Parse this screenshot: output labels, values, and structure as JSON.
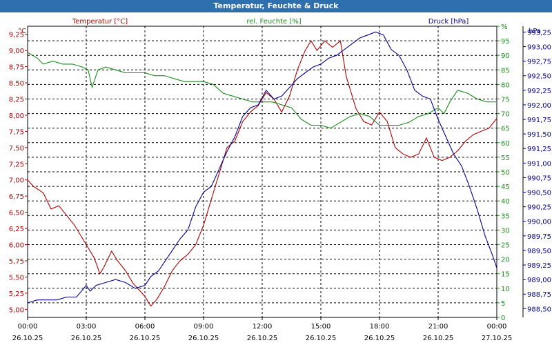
{
  "chart_data": {
    "type": "line",
    "title": "Temperatur, Feuchte & Druck",
    "legend": [
      {
        "label": "Temperatur [°C]",
        "color": "#b00000"
      },
      {
        "label": "rel. Feuchte [%]",
        "color": "#1a8a1a"
      },
      {
        "label": "Druck [hPa]",
        "color": "#00008c"
      }
    ],
    "axis_units": {
      "left": "°C",
      "right_inner": "%",
      "right_outer": "hPa"
    },
    "x_ticks": [
      {
        "time": "00:00",
        "date": "26.10.25"
      },
      {
        "time": "03:00",
        "date": "26.10.25"
      },
      {
        "time": "06:00",
        "date": "26.10.25"
      },
      {
        "time": "09:00",
        "date": "26.10.25"
      },
      {
        "time": "12:00",
        "date": "26.10.25"
      },
      {
        "time": "15:00",
        "date": "26.10.25"
      },
      {
        "time": "18:00",
        "date": "26.10.25"
      },
      {
        "time": "21:00",
        "date": "26.10.25"
      },
      {
        "time": "00:00",
        "date": "27.10.25"
      }
    ],
    "x_range_hours": [
      0,
      24
    ],
    "temp_axis": {
      "min": 4.875,
      "max": 9.375,
      "ticks": [
        "5,00",
        "5,25",
        "5,50",
        "5,75",
        "6,00",
        "6,25",
        "6,50",
        "6,75",
        "7,00",
        "7,25",
        "7,50",
        "7,75",
        "8,00",
        "8,25",
        "8,50",
        "8,75",
        "9,00",
        "9,25"
      ]
    },
    "humidity_axis": {
      "min": 0,
      "max": 100,
      "ticks": [
        "0",
        "5",
        "10",
        "15",
        "20",
        "25",
        "30",
        "35",
        "40",
        "45",
        "50",
        "55",
        "60",
        "65",
        "70",
        "75",
        "80",
        "85",
        "90",
        "95",
        "%"
      ]
    },
    "pressure_axis": {
      "min": 988.35,
      "max": 993.35,
      "ticks": [
        "988,50",
        "988,75",
        "989,00",
        "989,25",
        "989,50",
        "989,75",
        "990,00",
        "990,25",
        "990,50",
        "990,75",
        "991,00",
        "991,25",
        "991,50",
        "991,75",
        "992,00",
        "992,25",
        "992,50",
        "992,75",
        "993,00",
        "993,25"
      ]
    },
    "grid": true,
    "series": [
      {
        "name": "Temperatur [°C]",
        "color": "#b00000",
        "x": [
          0,
          0.3,
          0.8,
          1.2,
          1.6,
          2.0,
          2.4,
          2.8,
          3.0,
          3.4,
          3.7,
          3.9,
          4.3,
          4.6,
          5.0,
          5.4,
          5.7,
          6.0,
          6.3,
          6.6,
          7.0,
          7.4,
          7.8,
          8.2,
          8.6,
          9.0,
          9.4,
          9.8,
          10.2,
          10.6,
          11.0,
          11.4,
          11.8,
          12.2,
          12.6,
          13.0,
          13.4,
          13.8,
          14.2,
          14.5,
          14.8,
          15.2,
          15.6,
          16.0,
          16.3,
          16.8,
          17.2,
          17.6,
          18.0,
          18.4,
          18.8,
          19.2,
          19.6,
          20.0,
          20.4,
          20.8,
          21.2,
          21.6,
          22.0,
          22.4,
          22.8,
          23.2,
          23.6,
          24.0
        ],
        "y": [
          7.0,
          6.9,
          6.8,
          6.55,
          6.6,
          6.45,
          6.3,
          6.1,
          6.0,
          5.8,
          5.55,
          5.65,
          5.9,
          5.75,
          5.6,
          5.4,
          5.3,
          5.2,
          5.05,
          5.15,
          5.35,
          5.6,
          5.75,
          5.85,
          6.0,
          6.3,
          6.7,
          7.1,
          7.5,
          7.6,
          7.9,
          8.05,
          8.15,
          8.35,
          8.25,
          8.05,
          8.3,
          8.7,
          9.0,
          9.15,
          9.0,
          9.15,
          9.05,
          9.15,
          8.6,
          8.1,
          7.9,
          7.85,
          8.05,
          7.9,
          7.5,
          7.4,
          7.35,
          7.4,
          7.65,
          7.35,
          7.3,
          7.35,
          7.45,
          7.6,
          7.7,
          7.75,
          7.8,
          7.95
        ]
      },
      {
        "name": "rel. Feuchte [%]",
        "color": "#1a8a1a",
        "x": [
          0,
          0.5,
          0.8,
          1.3,
          1.8,
          2.3,
          2.8,
          3.1,
          3.3,
          3.6,
          4.0,
          4.5,
          5.0,
          5.5,
          6.0,
          6.5,
          7.0,
          7.5,
          8.0,
          8.5,
          9.0,
          9.5,
          10.0,
          10.5,
          11.0,
          11.5,
          12.0,
          12.5,
          13.0,
          13.5,
          14.0,
          14.5,
          15.0,
          15.5,
          16.0,
          16.5,
          17.0,
          17.5,
          18.0,
          18.5,
          19.0,
          19.5,
          20.0,
          20.5,
          21.0,
          21.3,
          21.6,
          22.0,
          22.5,
          23.0,
          23.5,
          24.0
        ],
        "y": [
          91,
          89,
          87,
          88,
          87,
          87,
          86,
          85,
          79,
          85,
          86,
          85,
          84,
          84,
          84,
          83,
          83,
          82,
          81,
          81,
          81,
          80,
          77,
          76,
          75,
          74,
          74,
          74,
          73,
          72,
          68,
          66,
          66,
          65,
          67,
          69,
          70,
          69,
          66,
          66,
          66,
          67,
          69,
          70,
          72,
          70,
          74,
          78,
          77,
          75,
          74,
          74
        ]
      },
      {
        "name": "Druck [hPa]",
        "color": "#00008c",
        "x": [
          0,
          0.5,
          1.0,
          1.5,
          2.0,
          2.5,
          3.0,
          3.2,
          3.5,
          4.0,
          4.5,
          5.0,
          5.5,
          6.0,
          6.3,
          6.7,
          7.0,
          7.4,
          7.8,
          8.2,
          8.6,
          9.0,
          9.4,
          9.8,
          10.2,
          10.6,
          11.0,
          11.4,
          11.8,
          12.2,
          12.6,
          13.0,
          13.4,
          13.8,
          14.2,
          14.6,
          15.0,
          15.4,
          15.8,
          16.2,
          16.6,
          17.0,
          17.4,
          17.8,
          18.2,
          18.6,
          19.0,
          19.4,
          19.8,
          20.2,
          20.6,
          21.0,
          21.4,
          21.8,
          22.2,
          22.6,
          23.0,
          23.4,
          23.8,
          24.0
        ],
        "y": [
          988.6,
          988.65,
          988.65,
          988.65,
          988.7,
          988.7,
          988.9,
          988.8,
          988.9,
          988.95,
          989.0,
          988.95,
          988.85,
          988.9,
          989.05,
          989.15,
          989.3,
          989.5,
          989.7,
          989.85,
          990.25,
          990.5,
          990.6,
          990.9,
          991.2,
          991.45,
          991.8,
          991.95,
          992.0,
          992.25,
          992.1,
          992.15,
          992.3,
          992.45,
          992.55,
          992.65,
          992.7,
          992.8,
          992.85,
          992.95,
          993.05,
          993.15,
          993.2,
          993.25,
          993.2,
          992.95,
          992.85,
          992.6,
          992.25,
          992.15,
          992.1,
          991.75,
          991.45,
          991.15,
          990.95,
          990.6,
          990.2,
          989.75,
          989.4,
          989.2
        ]
      }
    ]
  }
}
